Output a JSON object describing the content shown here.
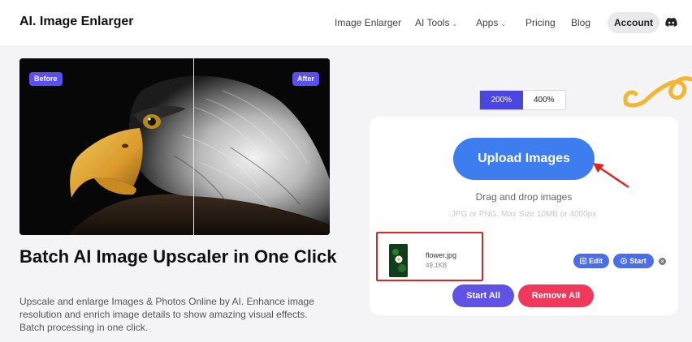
{
  "brand": "AI. Image Enlarger",
  "nav": {
    "items": [
      {
        "label": "Image Enlarger",
        "has_caret": false
      },
      {
        "label": "AI Tools",
        "has_caret": true
      },
      {
        "label": "Apps",
        "has_caret": true
      },
      {
        "label": "Pricing",
        "has_caret": false
      },
      {
        "label": "Blog",
        "has_caret": false
      }
    ],
    "account_label": "Account",
    "caret_glyph": "⌄",
    "discord_icon": "discord-icon"
  },
  "hero": {
    "before_label": "Before",
    "after_label": "After",
    "headline": "Batch AI Image Upscaler in One Click",
    "description": "Upscale and enlarge Images & Photos Online by AI. Enhance image resolution and enrich image details to show amazing visual effects. Batch processing in one click."
  },
  "scale": {
    "options": [
      "200%",
      "400%"
    ],
    "selected": "200%"
  },
  "upload": {
    "button_label": "Upload Images",
    "drag_text": "Drag and drop images",
    "hint_text": "JPG or PNG. Max Size 10MB or 4000px"
  },
  "file": {
    "name": "flower.jpg",
    "size": "49.1KB",
    "edit_label": "Edit",
    "start_label": "Start",
    "close_glyph": "✕"
  },
  "actions": {
    "start_all": "Start All",
    "remove_all": "Remove All"
  },
  "colors": {
    "upload_blue": "#3d7df0",
    "toggle_active": "#4b46e0",
    "badge_purple": "#5a4ff3",
    "start_all_purple": "#6152e6",
    "remove_all_red": "#f0395a",
    "highlight_red": "#e02424",
    "swirl_yellow": "#f2b630"
  }
}
